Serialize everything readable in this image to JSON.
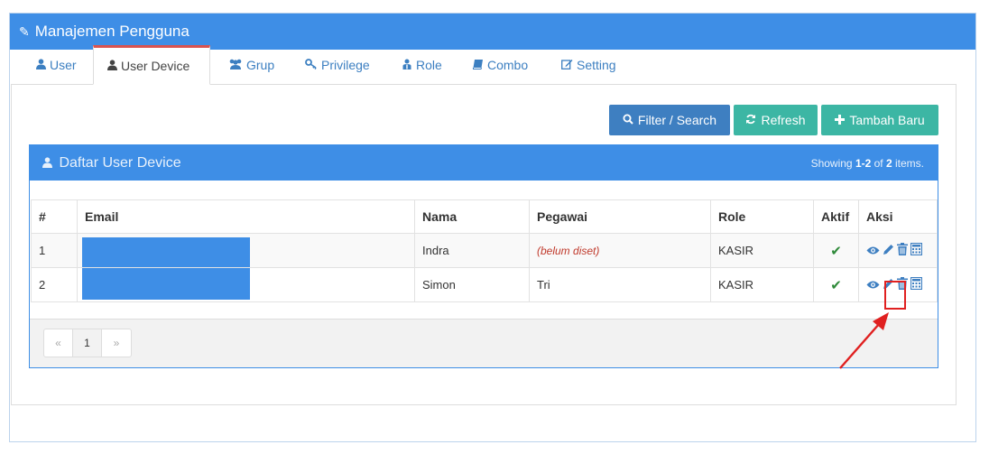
{
  "panel": {
    "title": "Manajemen Pengguna",
    "icon": "pencil-icon"
  },
  "tabs": [
    {
      "label": "User",
      "icon": "user-icon"
    },
    {
      "label": "User Device",
      "icon": "user-icon",
      "active": true
    },
    {
      "label": "Grup",
      "icon": "users-icon"
    },
    {
      "label": "Privilege",
      "icon": "key-icon"
    },
    {
      "label": "Role",
      "icon": "sitemap-icon"
    },
    {
      "label": "Combo",
      "icon": "book-icon"
    },
    {
      "label": "Setting",
      "icon": "edit-icon"
    }
  ],
  "toolbar": {
    "filter_label": "Filter / Search",
    "refresh_label": "Refresh",
    "add_label": "Tambah Baru"
  },
  "grid": {
    "title": "Daftar User Device",
    "summary_prefix": "Showing ",
    "summary_range": "1-2",
    "summary_mid": " of ",
    "summary_total": "2",
    "summary_suffix": " items.",
    "columns": [
      "#",
      "Email",
      "Nama",
      "Pegawai",
      "Role",
      "Aktif",
      "Aksi"
    ],
    "rows": [
      {
        "no": "1",
        "nama": "Indra",
        "pegawai": "(belum diset)",
        "pegawai_unset": true,
        "role": "KASIR"
      },
      {
        "no": "2",
        "nama": "Simon",
        "pegawai": "Tri",
        "pegawai_unset": false,
        "role": "KASIR"
      }
    ]
  },
  "pager": {
    "prev": "«",
    "page": "1",
    "next": "»"
  },
  "colors": {
    "primary": "#3e8ee6",
    "teal": "#3cb6a4",
    "danger": "#e02020",
    "success": "#2f8a3a"
  }
}
